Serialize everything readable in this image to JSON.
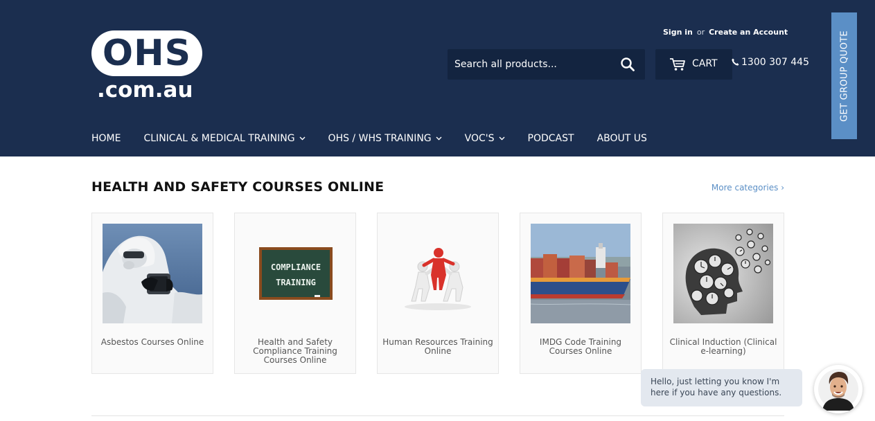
{
  "brand": {
    "logo_main": "OHS",
    "logo_domain": ".com.au"
  },
  "account": {
    "sign_in": "Sign in",
    "or": "or",
    "create_account": "Create an Account"
  },
  "search": {
    "placeholder": "Search all products..."
  },
  "cart": {
    "label": "CART"
  },
  "phone": {
    "number": "1300 307 445"
  },
  "group_quote": {
    "label": "GET GROUP QUOTE"
  },
  "nav": {
    "items": [
      {
        "label": "HOME",
        "dropdown": false
      },
      {
        "label": "CLINICAL & MEDICAL TRAINING",
        "dropdown": true
      },
      {
        "label": "OHS / WHS TRAINING",
        "dropdown": true
      },
      {
        "label": "VOC'S",
        "dropdown": true
      },
      {
        "label": "PODCAST",
        "dropdown": false
      },
      {
        "label": "ABOUT US",
        "dropdown": false
      }
    ]
  },
  "section": {
    "title": "HEALTH AND SAFETY COURSES ONLINE",
    "more_link": "More categories ›"
  },
  "categories": [
    {
      "title": "Asbestos Courses Online",
      "image": "asbestos-worker"
    },
    {
      "title": "Health and Safety Compliance Training Courses Online",
      "image": "compliance-chalkboard",
      "board_line1": "COMPLIANCE",
      "board_line2": "TRAINING"
    },
    {
      "title": "Human Resources Training Online",
      "image": "hr-figures"
    },
    {
      "title": "IMDG Code Training Courses Online",
      "image": "container-ship"
    },
    {
      "title": "Clinical Induction (Clinical e-learning)",
      "image": "clocks-head"
    }
  ],
  "chat": {
    "message": "Hello, just letting you know I'm here if you have any questions."
  },
  "colors": {
    "header_bg": "#1b2e4f",
    "search_bg": "#132440",
    "accent_blue": "#5b8fc6",
    "chat_bg": "#e3e8ef"
  }
}
